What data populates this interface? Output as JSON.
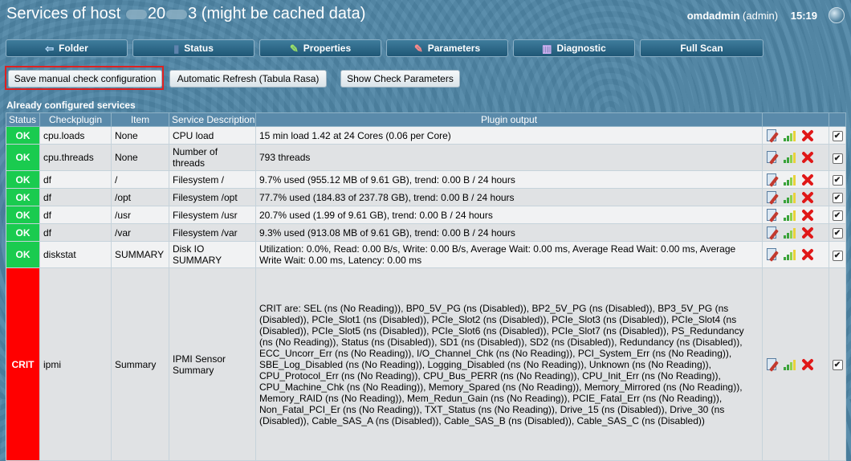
{
  "header": {
    "title_prefix": "Services of host",
    "title_mid": "20",
    "title_end": "3 (might be cached data)",
    "user": "omdadmin",
    "role": "(admin)",
    "time": "15:19"
  },
  "menu": [
    {
      "label": "Folder",
      "icon": "folder-back-icon",
      "glyph": "⇦"
    },
    {
      "label": "Status",
      "icon": "status-icon",
      "glyph": "▮"
    },
    {
      "label": "Properties",
      "icon": "edit-pencil-icon",
      "glyph": "✎"
    },
    {
      "label": "Parameters",
      "icon": "parameters-icon",
      "glyph": "✎"
    },
    {
      "label": "Diagnostic",
      "icon": "diagnostic-icon",
      "glyph": "▥"
    },
    {
      "label": "Full Scan",
      "icon": "",
      "glyph": ""
    }
  ],
  "actions": {
    "save": "Save manual check configuration",
    "refresh": "Automatic Refresh (Tabula Rasa)",
    "show_params": "Show Check Parameters"
  },
  "section_title": "Already configured services",
  "columns": [
    "Status",
    "Checkplugin",
    "Item",
    "Service Description",
    "Plugin output"
  ],
  "rows": [
    {
      "status": "OK",
      "plugin": "cpu.loads",
      "item": "None",
      "desc": "CPU load",
      "output": "15 min load 1.42 at 24 Cores (0.06 per Core)",
      "checked": true
    },
    {
      "status": "OK",
      "plugin": "cpu.threads",
      "item": "None",
      "desc": "Number of threads",
      "output": "793 threads",
      "checked": true
    },
    {
      "status": "OK",
      "plugin": "df",
      "item": "/",
      "desc": "Filesystem /",
      "output": "9.7% used (955.12 MB of 9.61 GB), trend: 0.00 B / 24 hours",
      "checked": true
    },
    {
      "status": "OK",
      "plugin": "df",
      "item": "/opt",
      "desc": "Filesystem /opt",
      "output": "77.7% used (184.83 of 237.78 GB), trend: 0.00 B / 24 hours",
      "checked": true
    },
    {
      "status": "OK",
      "plugin": "df",
      "item": "/usr",
      "desc": "Filesystem /usr",
      "output": "20.7% used (1.99 of 9.61 GB), trend: 0.00 B / 24 hours",
      "checked": true
    },
    {
      "status": "OK",
      "plugin": "df",
      "item": "/var",
      "desc": "Filesystem /var",
      "output": "9.3% used (913.08 MB of 9.61 GB), trend: 0.00 B / 24 hours",
      "checked": true
    },
    {
      "status": "OK",
      "plugin": "diskstat",
      "item": "SUMMARY",
      "desc": "Disk IO SUMMARY",
      "output": "Utilization: 0.0%, Read: 0.00 B/s, Write: 0.00 B/s, Average Wait: 0.00 ms, Average Read Wait: 0.00 ms, Average Write Wait: 0.00 ms, Latency: 0.00 ms",
      "checked": true
    },
    {
      "status": "CRIT",
      "plugin": "ipmi",
      "item": "Summary",
      "desc": "IPMI Sensor Summary",
      "output": "CRIT are: SEL (ns (No Reading)), BP0_5V_PG (ns (Disabled)), BP2_5V_PG (ns (Disabled)), BP3_5V_PG (ns (Disabled)), PCIe_Slot1 (ns (Disabled)), PCIe_Slot2 (ns (Disabled)), PCIe_Slot3 (ns (Disabled)), PCIe_Slot4 (ns (Disabled)), PCIe_Slot5 (ns (Disabled)), PCIe_Slot6 (ns (Disabled)), PCIe_Slot7 (ns (Disabled)), PS_Redundancy (ns (No Reading)), Status (ns (Disabled)), SD1 (ns (Disabled)), SD2 (ns (Disabled)), Redundancy (ns (Disabled)), ECC_Uncorr_Err (ns (No Reading)), I/O_Channel_Chk (ns (No Reading)), PCI_System_Err (ns (No Reading)), SBE_Log_Disabled (ns (No Reading)), Logging_Disabled (ns (No Reading)), Unknown (ns (No Reading)), CPU_Protocol_Err (ns (No Reading)), CPU_Bus_PERR (ns (No Reading)), CPU_Init_Err (ns (No Reading)), CPU_Machine_Chk (ns (No Reading)), Memory_Spared (ns (No Reading)), Memory_Mirrored (ns (No Reading)), Memory_RAID (ns (No Reading)), Mem_Redun_Gain (ns (No Reading)), PCIE_Fatal_Err (ns (No Reading)), Non_Fatal_PCI_Er (ns (No Reading)), TXT_Status (ns (No Reading)), Drive_15 (ns (Disabled)), Drive_30 (ns (Disabled)), Cable_SAS_A (ns (Disabled)), Cable_SAS_B (ns (Disabled)), Cable_SAS_C (ns (Disabled))",
      "checked": true
    }
  ],
  "colors": {
    "ok": "#1acb4f",
    "crit": "#ff0000",
    "header_bg": "#5a8aaa",
    "button_bg": "#1f5776"
  }
}
